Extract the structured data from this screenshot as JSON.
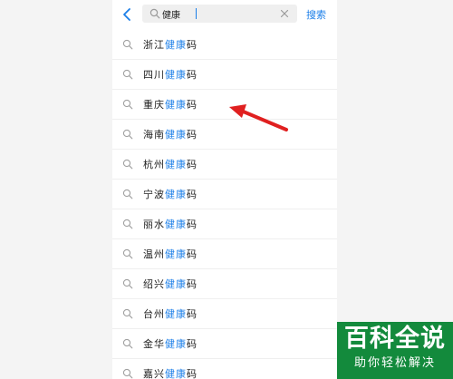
{
  "search": {
    "value": "健康",
    "button_label": "搜索"
  },
  "suggestions": [
    {
      "prefix": "浙江",
      "highlight": "健康",
      "suffix": "码"
    },
    {
      "prefix": "四川",
      "highlight": "健康",
      "suffix": "码"
    },
    {
      "prefix": "重庆",
      "highlight": "健康",
      "suffix": "码"
    },
    {
      "prefix": "海南",
      "highlight": "健康",
      "suffix": "码"
    },
    {
      "prefix": "杭州",
      "highlight": "健康",
      "suffix": "码"
    },
    {
      "prefix": "宁波",
      "highlight": "健康",
      "suffix": "码"
    },
    {
      "prefix": "丽水",
      "highlight": "健康",
      "suffix": "码"
    },
    {
      "prefix": "温州",
      "highlight": "健康",
      "suffix": "码"
    },
    {
      "prefix": "绍兴",
      "highlight": "健康",
      "suffix": "码"
    },
    {
      "prefix": "台州",
      "highlight": "健康",
      "suffix": "码"
    },
    {
      "prefix": "金华",
      "highlight": "健康",
      "suffix": "码"
    },
    {
      "prefix": "嘉兴",
      "highlight": "健康",
      "suffix": "码"
    }
  ],
  "watermark": {
    "title": "百科全说",
    "subtitle": "助你轻松解决"
  },
  "colors": {
    "accent": "#1a7ee8",
    "annotation_arrow": "#e02020",
    "watermark_bg": "#138a3c"
  },
  "icons": {
    "back": "chevron-left-icon",
    "search": "search-icon",
    "clear": "clear-icon",
    "annotation": "arrow-icon"
  }
}
